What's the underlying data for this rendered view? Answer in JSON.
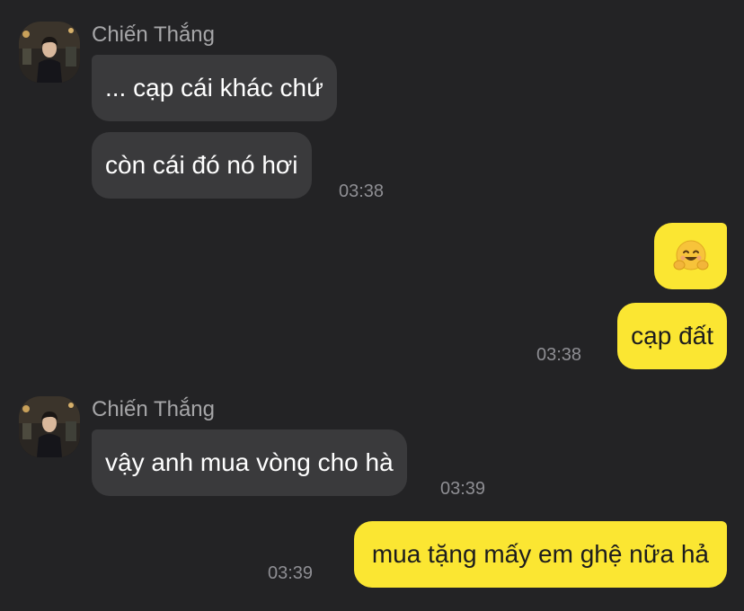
{
  "colors": {
    "background": "#232325",
    "incoming_bubble": "#3a3a3c",
    "outgoing_bubble": "#fbe632",
    "timestamp": "#8e8e93",
    "sender_name": "#a6a6a8"
  },
  "messages": {
    "group1": {
      "sender": "Chiến Thắng",
      "bubble1": "... cạp cái khác chứ",
      "bubble2": "còn cái đó nó hơi",
      "time": "03:38"
    },
    "group2": {
      "emoji": "smiling-face-with-open-hands-emoji",
      "bubble": "cạp đất",
      "time": "03:38"
    },
    "group3": {
      "sender": "Chiến Thắng",
      "bubble": "vậy anh mua vòng cho hà",
      "time": "03:39"
    },
    "group4": {
      "bubble": "mua tặng mấy em ghệ nữa hả",
      "time": "03:39"
    }
  }
}
